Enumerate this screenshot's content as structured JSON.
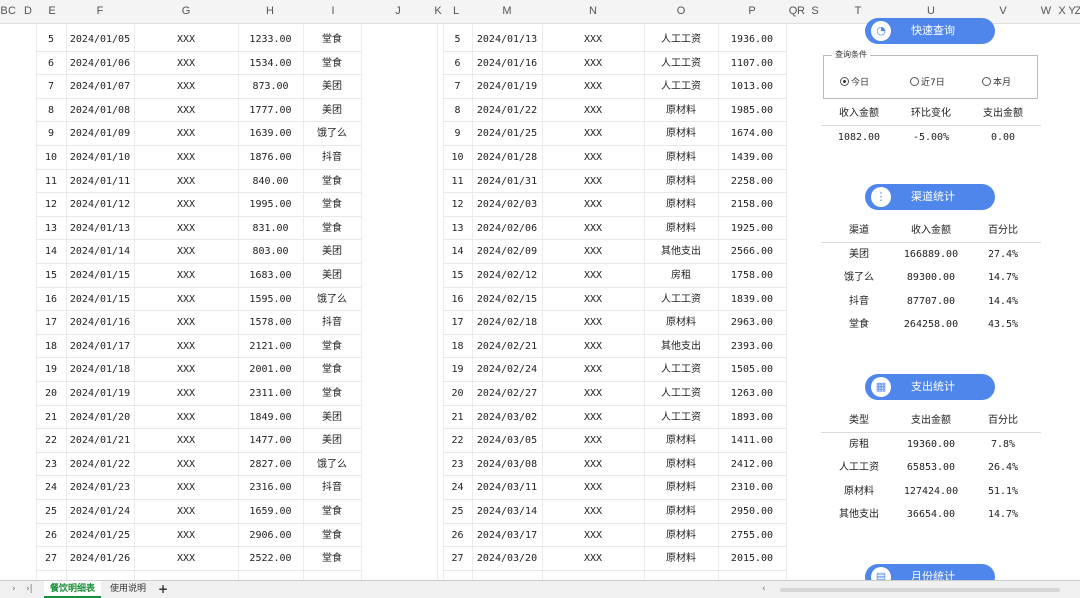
{
  "columns": [
    "B",
    "C",
    "D",
    "E",
    "F",
    "G",
    "H",
    "I",
    "J",
    "K",
    "L",
    "M",
    "N",
    "O",
    "P",
    "Q",
    "R",
    "S",
    "T",
    "U",
    "V",
    "W",
    "X",
    "Y",
    "Z"
  ],
  "left_table": [
    [
      "5",
      "2024/01/05",
      "XXX",
      "1233.00",
      "堂食"
    ],
    [
      "6",
      "2024/01/06",
      "XXX",
      "1534.00",
      "堂食"
    ],
    [
      "7",
      "2024/01/07",
      "XXX",
      "873.00",
      "美团"
    ],
    [
      "8",
      "2024/01/08",
      "XXX",
      "1777.00",
      "美团"
    ],
    [
      "9",
      "2024/01/09",
      "XXX",
      "1639.00",
      "饿了么"
    ],
    [
      "10",
      "2024/01/10",
      "XXX",
      "1876.00",
      "抖音"
    ],
    [
      "11",
      "2024/01/11",
      "XXX",
      "840.00",
      "堂食"
    ],
    [
      "12",
      "2024/01/12",
      "XXX",
      "1995.00",
      "堂食"
    ],
    [
      "13",
      "2024/01/13",
      "XXX",
      "831.00",
      "堂食"
    ],
    [
      "14",
      "2024/01/14",
      "XXX",
      "803.00",
      "美团"
    ],
    [
      "15",
      "2024/01/15",
      "XXX",
      "1683.00",
      "美团"
    ],
    [
      "16",
      "2024/01/15",
      "XXX",
      "1595.00",
      "饿了么"
    ],
    [
      "17",
      "2024/01/16",
      "XXX",
      "1578.00",
      "抖音"
    ],
    [
      "18",
      "2024/01/17",
      "XXX",
      "2121.00",
      "堂食"
    ],
    [
      "19",
      "2024/01/18",
      "XXX",
      "2001.00",
      "堂食"
    ],
    [
      "20",
      "2024/01/19",
      "XXX",
      "2311.00",
      "堂食"
    ],
    [
      "21",
      "2024/01/20",
      "XXX",
      "1849.00",
      "美团"
    ],
    [
      "22",
      "2024/01/21",
      "XXX",
      "1477.00",
      "美团"
    ],
    [
      "23",
      "2024/01/22",
      "XXX",
      "2827.00",
      "饿了么"
    ],
    [
      "24",
      "2024/01/23",
      "XXX",
      "2316.00",
      "抖音"
    ],
    [
      "25",
      "2024/01/24",
      "XXX",
      "1659.00",
      "堂食"
    ],
    [
      "26",
      "2024/01/25",
      "XXX",
      "2906.00",
      "堂食"
    ],
    [
      "27",
      "2024/01/26",
      "XXX",
      "2522.00",
      "堂食"
    ]
  ],
  "right_table": [
    [
      "5",
      "2024/01/13",
      "XXX",
      "人工工资",
      "1936.00"
    ],
    [
      "6",
      "2024/01/16",
      "XXX",
      "人工工资",
      "1107.00"
    ],
    [
      "7",
      "2024/01/19",
      "XXX",
      "人工工资",
      "1013.00"
    ],
    [
      "8",
      "2024/01/22",
      "XXX",
      "原材料",
      "1985.00"
    ],
    [
      "9",
      "2024/01/25",
      "XXX",
      "原材料",
      "1674.00"
    ],
    [
      "10",
      "2024/01/28",
      "XXX",
      "原材料",
      "1439.00"
    ],
    [
      "11",
      "2024/01/31",
      "XXX",
      "原材料",
      "2258.00"
    ],
    [
      "12",
      "2024/02/03",
      "XXX",
      "原材料",
      "2158.00"
    ],
    [
      "13",
      "2024/02/06",
      "XXX",
      "原材料",
      "1925.00"
    ],
    [
      "14",
      "2024/02/09",
      "XXX",
      "其他支出",
      "2566.00"
    ],
    [
      "15",
      "2024/02/12",
      "XXX",
      "房租",
      "1758.00"
    ],
    [
      "16",
      "2024/02/15",
      "XXX",
      "人工工资",
      "1839.00"
    ],
    [
      "17",
      "2024/02/18",
      "XXX",
      "原材料",
      "2963.00"
    ],
    [
      "18",
      "2024/02/21",
      "XXX",
      "其他支出",
      "2393.00"
    ],
    [
      "19",
      "2024/02/24",
      "XXX",
      "人工工资",
      "1505.00"
    ],
    [
      "20",
      "2024/02/27",
      "XXX",
      "人工工资",
      "1263.00"
    ],
    [
      "21",
      "2024/03/02",
      "XXX",
      "人工工资",
      "1893.00"
    ],
    [
      "22",
      "2024/03/05",
      "XXX",
      "原材料",
      "1411.00"
    ],
    [
      "23",
      "2024/03/08",
      "XXX",
      "原材料",
      "2412.00"
    ],
    [
      "24",
      "2024/03/11",
      "XXX",
      "原材料",
      "2310.00"
    ],
    [
      "25",
      "2024/03/14",
      "XXX",
      "原材料",
      "2950.00"
    ],
    [
      "26",
      "2024/03/17",
      "XXX",
      "原材料",
      "2755.00"
    ],
    [
      "27",
      "2024/03/20",
      "XXX",
      "原材料",
      "2015.00"
    ]
  ],
  "panel": {
    "quick_query": {
      "label": "快速查询",
      "icon": "chat-icon"
    },
    "query_box": {
      "legend": "查询条件",
      "options": [
        "今日",
        "近7日",
        "本月"
      ],
      "selected": "今日"
    },
    "summary": {
      "headers": [
        "收入金额",
        "环比变化",
        "支出金额"
      ],
      "values": [
        "1082.00",
        "-5.00%",
        "0.00"
      ]
    },
    "channel": {
      "label": "渠道统计",
      "icon": "share-icon",
      "headers": [
        "渠道",
        "收入金额",
        "百分比"
      ],
      "rows": [
        [
          "美团",
          "166889.00",
          "27.4%"
        ],
        [
          "饿了么",
          "89300.00",
          "14.7%"
        ],
        [
          "抖音",
          "87707.00",
          "14.4%"
        ],
        [
          "堂食",
          "264258.00",
          "43.5%"
        ]
      ]
    },
    "expense": {
      "label": "支出统计",
      "icon": "grid-icon",
      "headers": [
        "类型",
        "支出金额",
        "百分比"
      ],
      "rows": [
        [
          "房租",
          "19360.00",
          "7.8%"
        ],
        [
          "人工工资",
          "65853.00",
          "26.4%"
        ],
        [
          "原材料",
          "127424.00",
          "51.1%"
        ],
        [
          "其他支出",
          "36654.00",
          "14.7%"
        ]
      ]
    },
    "monthly": {
      "label": "月份统计",
      "icon": "calendar-icon"
    }
  },
  "sheet_tabs": {
    "active": "餐饮明细表",
    "other": "使用说明",
    "add": "+"
  },
  "colors": {
    "accent": "#4f86ec",
    "active_tab": "#1a8f3a"
  }
}
